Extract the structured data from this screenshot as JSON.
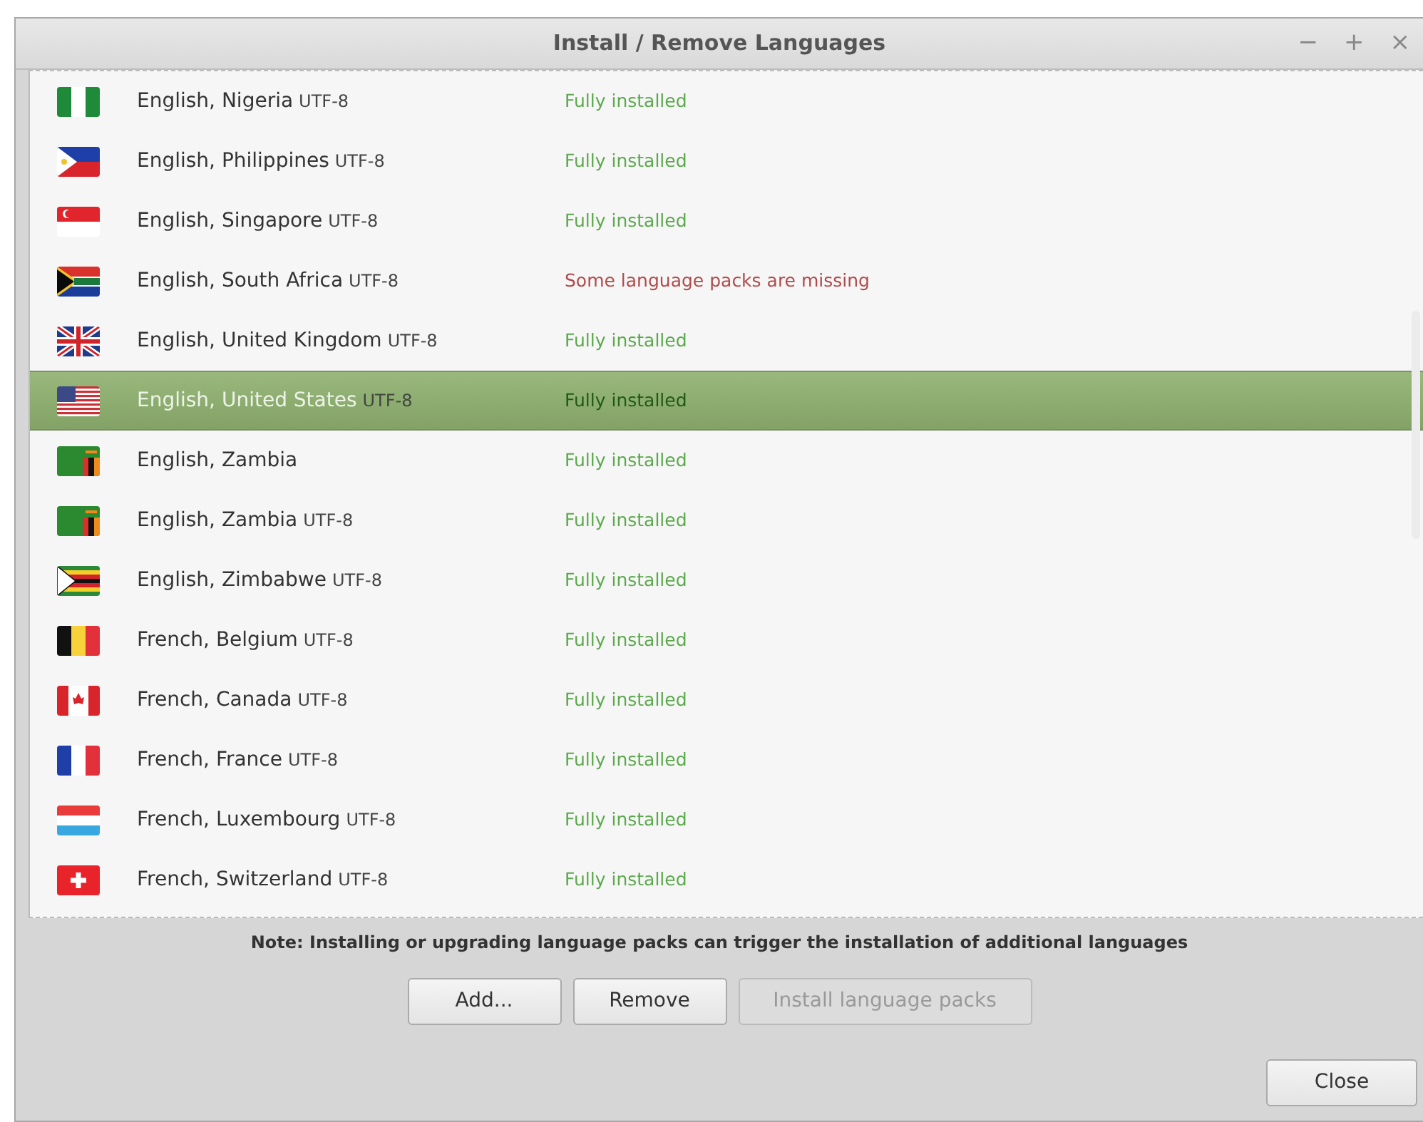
{
  "window": {
    "title": "Install / Remove Languages",
    "controls": [
      "−",
      "+",
      "×"
    ]
  },
  "languages": [
    {
      "name": "English, Nigeria",
      "encoding": "UTF-8",
      "status": "Fully installed",
      "complete": true,
      "selected": false,
      "kind": "ng"
    },
    {
      "name": "English, Philippines",
      "encoding": "UTF-8",
      "status": "Fully installed",
      "complete": true,
      "selected": false,
      "kind": "ph"
    },
    {
      "name": "English, Singapore",
      "encoding": "UTF-8",
      "status": "Fully installed",
      "complete": true,
      "selected": false,
      "kind": "sg"
    },
    {
      "name": "English, South Africa",
      "encoding": "UTF-8",
      "status": "Some language packs are missing",
      "complete": false,
      "selected": false,
      "kind": "za"
    },
    {
      "name": "English, United Kingdom",
      "encoding": "UTF-8",
      "status": "Fully installed",
      "complete": true,
      "selected": false,
      "kind": "gb"
    },
    {
      "name": "English, United States",
      "encoding": "UTF-8",
      "status": "Fully installed",
      "complete": true,
      "selected": true,
      "kind": "us"
    },
    {
      "name": "English, Zambia",
      "status": "Fully installed",
      "complete": true,
      "selected": false,
      "kind": "zm"
    },
    {
      "name": "English, Zambia",
      "encoding": "UTF-8",
      "status": "Fully installed",
      "complete": true,
      "selected": false,
      "kind": "zm"
    },
    {
      "name": "English, Zimbabwe",
      "encoding": "UTF-8",
      "status": "Fully installed",
      "complete": true,
      "selected": false,
      "kind": "zw"
    },
    {
      "name": "French, Belgium",
      "encoding": "UTF-8",
      "status": "Fully installed",
      "complete": true,
      "selected": false,
      "kind": "be"
    },
    {
      "name": "French, Canada",
      "encoding": "UTF-8",
      "status": "Fully installed",
      "complete": true,
      "selected": false,
      "kind": "ca"
    },
    {
      "name": "French, France",
      "encoding": "UTF-8",
      "status": "Fully installed",
      "complete": true,
      "selected": false,
      "kind": "fr"
    },
    {
      "name": "French, Luxembourg",
      "encoding": "UTF-8",
      "status": "Fully installed",
      "complete": true,
      "selected": false,
      "kind": "lu"
    },
    {
      "name": "French, Switzerland",
      "encoding": "UTF-8",
      "status": "Fully installed",
      "complete": true,
      "selected": false,
      "kind": "ch"
    }
  ],
  "note": "Note: Installing or upgrading language packs can trigger the installation of additional languages",
  "buttons": [
    {
      "label": "Add...",
      "disabled": false
    },
    {
      "label": "Remove",
      "disabled": false
    },
    {
      "label": "Install language packs",
      "disabled": true
    }
  ],
  "close_button": "Close"
}
